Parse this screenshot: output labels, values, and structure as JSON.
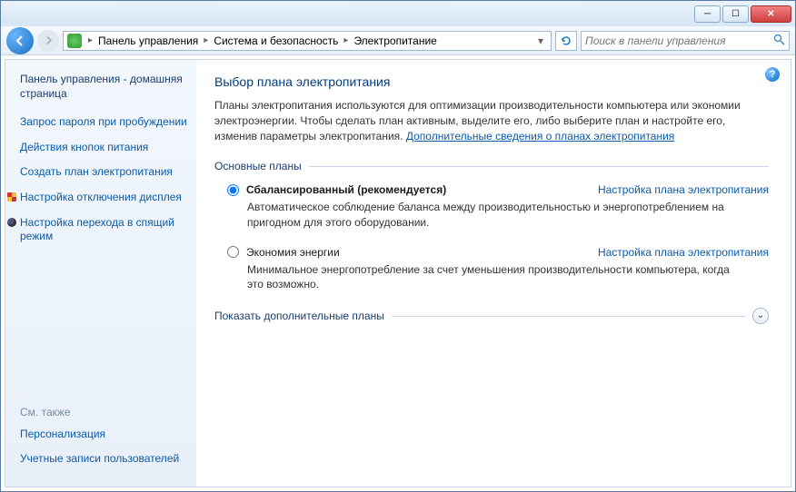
{
  "breadcrumb": {
    "seg1": "Панель управления",
    "seg2": "Система и безопасность",
    "seg3": "Электропитание"
  },
  "search": {
    "placeholder": "Поиск в панели управления"
  },
  "sidebar": {
    "home": "Панель управления - домашняя страница",
    "tasks": {
      "t0": "Запрос пароля при пробуждении",
      "t1": "Действия кнопок питания",
      "t2": "Создать план электропитания",
      "t3": "Настройка отключения дисплея",
      "t4": "Настройка перехода в спящий режим"
    },
    "seealso_h": "См. также",
    "seealso": {
      "s0": "Персонализация",
      "s1": "Учетные записи пользователей"
    }
  },
  "content": {
    "title": "Выбор плана электропитания",
    "desc_part1": "Планы электропитания используются для оптимизации производительности компьютера или экономии электроэнергии. Чтобы сделать план активным, выделите его, либо выберите план и настройте его, изменив параметры электропитания. ",
    "desc_link": "Дополнительные сведения о планах электропитания",
    "group_main": "Основные планы",
    "group_extra": "Показать дополнительные планы",
    "config_link": "Настройка плана электропитания",
    "plans": {
      "p0": {
        "name": "Сбалансированный (рекомендуется)",
        "desc": "Автоматическое соблюдение баланса между производительностью и энергопотреблением на пригодном для этого оборудовании."
      },
      "p1": {
        "name": "Экономия энергии",
        "desc": "Минимальное энергопотребление за счет уменьшения производительности компьютера, когда это возможно."
      }
    }
  }
}
